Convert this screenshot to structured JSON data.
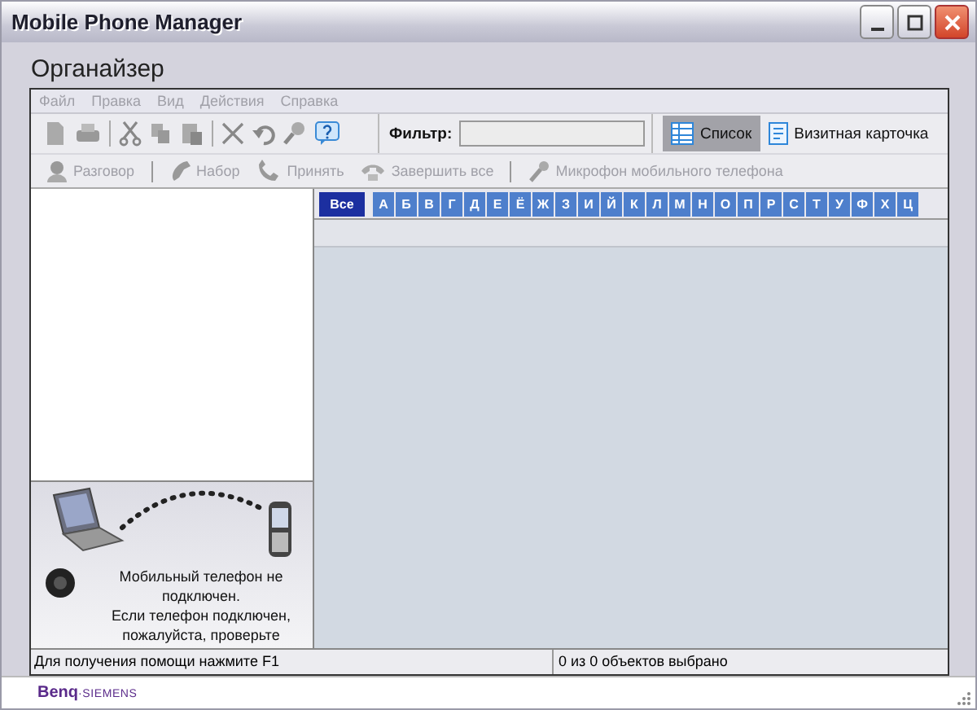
{
  "window": {
    "title": "Mobile Phone Manager"
  },
  "heading": "Органайзер",
  "menu": [
    {
      "label": "Файл",
      "disabled": true
    },
    {
      "label": "Правка",
      "disabled": true
    },
    {
      "label": "Вид",
      "disabled": true
    },
    {
      "label": "Действия",
      "disabled": true
    },
    {
      "label": "Справка",
      "disabled": true
    }
  ],
  "toolbar": {
    "filter_label": "Фильтр:",
    "views": [
      {
        "label": "Список",
        "selected": true,
        "kind": "list"
      },
      {
        "label": "Визитная карточка",
        "selected": false,
        "kind": "card"
      }
    ]
  },
  "actions": [
    {
      "label": "Разговор",
      "kind": "talk",
      "disabled": true
    },
    {
      "label": "Набор",
      "kind": "dial",
      "disabled": true
    },
    {
      "label": "Принять",
      "kind": "accept",
      "disabled": true
    },
    {
      "label": "Завершить все",
      "kind": "hangup",
      "disabled": true
    },
    {
      "label": "Микрофон мобильного телефона",
      "kind": "mic",
      "disabled": true
    }
  ],
  "letters": [
    {
      "label": "Все",
      "selected": true
    },
    {
      "label": "А",
      "selected": false
    },
    {
      "label": "Б",
      "selected": false
    },
    {
      "label": "В",
      "selected": false
    },
    {
      "label": "Г",
      "selected": false
    },
    {
      "label": "Д",
      "selected": false
    },
    {
      "label": "Е",
      "selected": false
    },
    {
      "label": "Ё",
      "selected": false
    },
    {
      "label": "Ж",
      "selected": false
    },
    {
      "label": "З",
      "selected": false
    },
    {
      "label": "И",
      "selected": false
    },
    {
      "label": "Й",
      "selected": false
    },
    {
      "label": "К",
      "selected": false
    },
    {
      "label": "Л",
      "selected": false
    },
    {
      "label": "М",
      "selected": false
    },
    {
      "label": "Н",
      "selected": false
    },
    {
      "label": "О",
      "selected": false
    },
    {
      "label": "П",
      "selected": false
    },
    {
      "label": "Р",
      "selected": false
    },
    {
      "label": "С",
      "selected": false
    },
    {
      "label": "Т",
      "selected": false
    },
    {
      "label": "У",
      "selected": false
    },
    {
      "label": "Ф",
      "selected": false
    },
    {
      "label": "Х",
      "selected": false
    },
    {
      "label": "Ц",
      "selected": false
    }
  ],
  "connection": {
    "message": "Мобильный телефон не подключен.\nЕсли телефон подключен, пожалуйста, проверьте"
  },
  "status_bar": {
    "help": "Для получения помощи нажмите F1",
    "selection": "0 из 0 объектов выбрано"
  },
  "footer": {
    "logo_main": "Benq",
    "logo_sub": "·SIEMENS"
  }
}
